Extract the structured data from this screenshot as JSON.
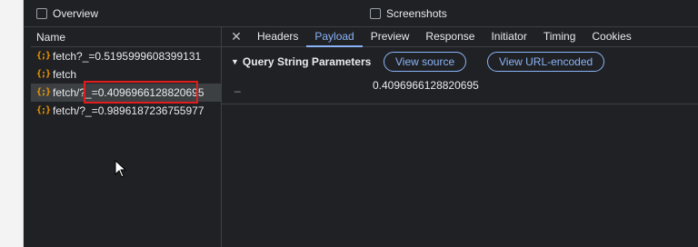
{
  "options": {
    "overview_label": "Overview",
    "screenshots_label": "Screenshots"
  },
  "name_panel": {
    "header": "Name",
    "icon_glyph": "{;}",
    "items": [
      {
        "label": "fetch?_=0.5195999608399131"
      },
      {
        "label": "fetch"
      },
      {
        "label": "fetch/?_=0.4096966128820695"
      },
      {
        "label": "fetch/?_=0.9896187236755977"
      }
    ]
  },
  "details": {
    "close_glyph": "✕",
    "tabs": [
      {
        "label": "Headers"
      },
      {
        "label": "Payload"
      },
      {
        "label": "Preview"
      },
      {
        "label": "Response"
      },
      {
        "label": "Initiator"
      },
      {
        "label": "Timing"
      },
      {
        "label": "Cookies"
      }
    ],
    "active_tab": "Payload",
    "section_title": "Query String Parameters",
    "section_toggle_glyph": "▼",
    "view_source_label": "View source",
    "view_url_encoded_label": "View URL-encoded",
    "param": {
      "name": "_",
      "value": "0.4096966128820695"
    }
  },
  "colors": {
    "accent": "#8ab4f8",
    "highlight": "#e21c1c",
    "fetch_icon": "#f29900"
  }
}
